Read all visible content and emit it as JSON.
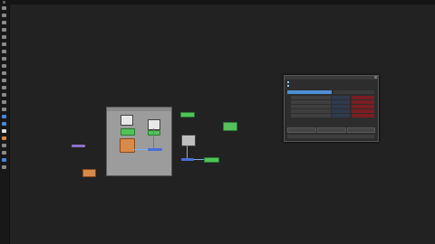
{
  "window": {
    "title": ""
  },
  "toolbar": {
    "icons": [
      "select-icon",
      "transform-icon",
      "grid-icon",
      "text-icon",
      "shape-icon",
      "brush-icon",
      "paint-icon",
      "eraser-icon",
      "fill-icon",
      "crop-icon",
      "pen-icon",
      "zoom-icon",
      "hand-icon",
      "node-icon",
      "link-icon",
      "color-icon",
      "layer-icon",
      "filter-icon",
      "mask-icon",
      "light-icon",
      "camera-icon",
      "render-icon",
      "settings-icon",
      "help-icon",
      "script-icon",
      "plugin-icon",
      "info-icon",
      "merge-icon",
      "split-icon",
      "bake-icon",
      "export-icon"
    ]
  },
  "dialog": {
    "title": "",
    "info_lines": [
      "",
      ""
    ],
    "tabs": [
      "",
      ""
    ],
    "rows": [
      {
        "idx": "",
        "name": "",
        "status": ""
      },
      {
        "idx": "",
        "name": "",
        "status": ""
      },
      {
        "idx": "",
        "name": "",
        "status": ""
      },
      {
        "idx": "",
        "name": "",
        "status": ""
      },
      {
        "idx": "",
        "name": "",
        "status": ""
      }
    ],
    "buttons": [
      "",
      "",
      ""
    ],
    "ok_label": ""
  },
  "colors": {
    "node_green": "#52c25a",
    "node_purple": "#8a72c8",
    "node_orange": "#d88a4a",
    "node_blue": "#4a6ed8",
    "dialog_red": "#7a1e22",
    "tab_active": "#4d8fd6"
  }
}
